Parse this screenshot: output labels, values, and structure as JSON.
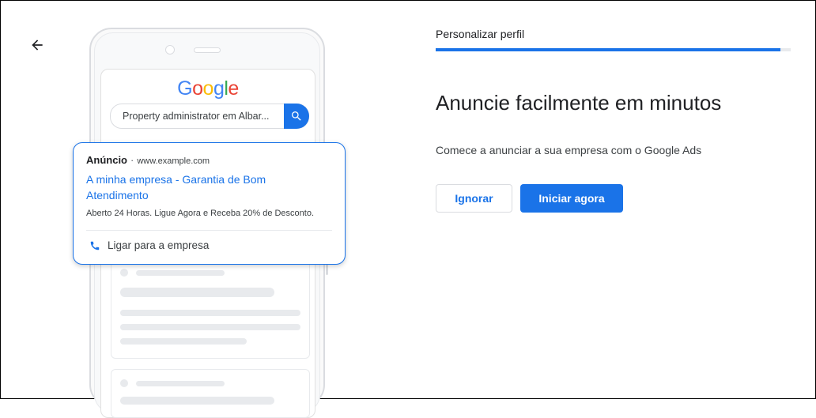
{
  "header": {
    "step_label": "Personalizar perfil",
    "progress": 0.97
  },
  "main": {
    "headline": "Anuncie facilmente em minutos",
    "subtext": "Comece a anunciar a sua empresa com o Google Ads",
    "skip_label": "Ignorar",
    "start_label": "Iniciar agora"
  },
  "preview": {
    "logo_text": "Google",
    "search_query": "Property administrator em Albar...",
    "ad": {
      "label": "Anúncio",
      "separator": "·",
      "url": "www.example.com",
      "title": "A minha empresa - Garantia de Bom Atendimento",
      "description": "Aberto 24 Horas. Ligue Agora e Receba 20% de Desconto.",
      "call_label": "Ligar para a empresa"
    }
  },
  "colors": {
    "accent": "#1a73e8",
    "skeleton": "#e8eaed",
    "border": "#dadce0"
  },
  "icons": {
    "back": "arrow-left-icon",
    "search": "search-icon",
    "phone": "phone-icon"
  }
}
